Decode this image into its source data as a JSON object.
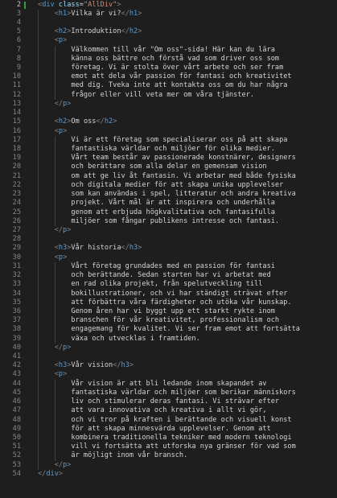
{
  "editor": {
    "active_line": 2,
    "modified_lines": [
      2
    ],
    "lines": [
      {
        "n": 2,
        "indent": 0,
        "kind": "open",
        "tag": "div",
        "attr": "class",
        "value": "\"AllDiv\""
      },
      {
        "n": 3,
        "indent": 1,
        "kind": "element",
        "tag": "h1",
        "text": "Vilka är vi?"
      },
      {
        "n": 4,
        "indent": 1,
        "kind": "blank"
      },
      {
        "n": 5,
        "indent": 1,
        "kind": "element",
        "tag": "h2",
        "text": "Introduktion"
      },
      {
        "n": 6,
        "indent": 1,
        "kind": "open",
        "tag": "p"
      },
      {
        "n": 7,
        "indent": 2,
        "kind": "text",
        "text": "Välkommen till vår \"Om oss\"-sida! Här kan du lära"
      },
      {
        "n": 8,
        "indent": 2,
        "kind": "text",
        "text": "känna oss bättre och förstå vad som driver oss som"
      },
      {
        "n": 9,
        "indent": 2,
        "kind": "text",
        "text": "företag. Vi är stolta över vårt arbete och ser fram"
      },
      {
        "n": 10,
        "indent": 2,
        "kind": "text",
        "text": "emot att dela vår passion för fantasi och kreativitet"
      },
      {
        "n": 11,
        "indent": 2,
        "kind": "text",
        "text": "med dig. Tveka inte att kontakta oss om du har några"
      },
      {
        "n": 12,
        "indent": 2,
        "kind": "text",
        "text": "frågor eller vill veta mer om våra tjänster."
      },
      {
        "n": 13,
        "indent": 1,
        "kind": "close",
        "tag": "p"
      },
      {
        "n": 14,
        "indent": 1,
        "kind": "blank"
      },
      {
        "n": 15,
        "indent": 1,
        "kind": "element",
        "tag": "h2",
        "text": "Om oss"
      },
      {
        "n": 16,
        "indent": 1,
        "kind": "open",
        "tag": "p"
      },
      {
        "n": 17,
        "indent": 2,
        "kind": "text",
        "text": "Vi är ett företag som specialiserar oss på att skapa"
      },
      {
        "n": 18,
        "indent": 2,
        "kind": "text",
        "text": "fantastiska världar och miljöer för olika medier."
      },
      {
        "n": 19,
        "indent": 2,
        "kind": "text",
        "text": "Vårt team består av passionerade konstnärer, designers"
      },
      {
        "n": 20,
        "indent": 2,
        "kind": "text",
        "text": "och berättare som alla delar en gemensam vision"
      },
      {
        "n": 21,
        "indent": 2,
        "kind": "text",
        "text": "om att ge liv åt fantasin. Vi arbetar med både fysiska"
      },
      {
        "n": 22,
        "indent": 2,
        "kind": "text",
        "text": "och digitala medier för att skapa unika upplevelser"
      },
      {
        "n": 23,
        "indent": 2,
        "kind": "text",
        "text": "som kan användas i spel, litteratur och andra kreativa"
      },
      {
        "n": 24,
        "indent": 2,
        "kind": "text",
        "text": "projekt. Vårt mål är att inspirera och underhålla"
      },
      {
        "n": 25,
        "indent": 2,
        "kind": "text",
        "text": "genom att erbjuda högkvalitativa och fantasifulla"
      },
      {
        "n": 26,
        "indent": 2,
        "kind": "text",
        "text": "miljöer som fångar publikens intresse och fantasi."
      },
      {
        "n": 27,
        "indent": 1,
        "kind": "close",
        "tag": "p"
      },
      {
        "n": 28,
        "indent": 1,
        "kind": "blank"
      },
      {
        "n": 29,
        "indent": 1,
        "kind": "element",
        "tag": "h3",
        "text": "Vår historia"
      },
      {
        "n": 30,
        "indent": 1,
        "kind": "open",
        "tag": "p"
      },
      {
        "n": 31,
        "indent": 2,
        "kind": "text",
        "text": "Vårt företag grundades med en passion för fantasi"
      },
      {
        "n": 32,
        "indent": 2,
        "kind": "text",
        "text": "och berättande. Sedan starten har vi arbetat med"
      },
      {
        "n": 33,
        "indent": 2,
        "kind": "text",
        "text": "en rad olika projekt, från spelutveckling till"
      },
      {
        "n": 34,
        "indent": 2,
        "kind": "text",
        "text": "bokillustrationer, och vi har ständigt strävat efter"
      },
      {
        "n": 35,
        "indent": 2,
        "kind": "text",
        "text": "att förbättra våra färdigheter och utöka vår kunskap."
      },
      {
        "n": 36,
        "indent": 2,
        "kind": "text",
        "text": "Genom åren har vi byggt upp ett starkt rykte inom"
      },
      {
        "n": 37,
        "indent": 2,
        "kind": "text",
        "text": "branschen för vår kreativitet, professionalism och"
      },
      {
        "n": 38,
        "indent": 2,
        "kind": "text",
        "text": "engagemang för kvalitet. Vi ser fram emot att fortsätta"
      },
      {
        "n": 39,
        "indent": 2,
        "kind": "text",
        "text": "växa och utvecklas i framtiden."
      },
      {
        "n": 40,
        "indent": 1,
        "kind": "close",
        "tag": "p"
      },
      {
        "n": 41,
        "indent": 1,
        "kind": "blank"
      },
      {
        "n": 42,
        "indent": 1,
        "kind": "element",
        "tag": "h3",
        "text": "Vår vision"
      },
      {
        "n": 43,
        "indent": 1,
        "kind": "open",
        "tag": "p"
      },
      {
        "n": 44,
        "indent": 2,
        "kind": "text",
        "text": "Vår vision är att bli ledande inom skapandet av"
      },
      {
        "n": 45,
        "indent": 2,
        "kind": "text",
        "text": "fantastiska världar och miljöer som berikar människors"
      },
      {
        "n": 46,
        "indent": 2,
        "kind": "text",
        "text": "liv och stimulerar deras fantasi. Vi strävar efter"
      },
      {
        "n": 47,
        "indent": 2,
        "kind": "text",
        "text": "att vara innovativa och kreativa i allt vi gör,"
      },
      {
        "n": 48,
        "indent": 2,
        "kind": "text",
        "text": "och vi tror på kraften i berättande och visuell konst"
      },
      {
        "n": 49,
        "indent": 2,
        "kind": "text",
        "text": "för att skapa minnesvärda upplevelser. Genom att"
      },
      {
        "n": 50,
        "indent": 2,
        "kind": "text",
        "text": "kombinera traditionella tekniker med modern teknologi"
      },
      {
        "n": 51,
        "indent": 2,
        "kind": "text",
        "text": "vill vi fortsätta att utforska nya gränser för vad som"
      },
      {
        "n": 52,
        "indent": 2,
        "kind": "text",
        "text": "är möjligt inom vår bransch."
      },
      {
        "n": 53,
        "indent": 1,
        "kind": "close",
        "tag": "p"
      },
      {
        "n": 54,
        "indent": 0,
        "kind": "close",
        "tag": "div"
      }
    ]
  },
  "colors": {
    "background": "#1e1e1e",
    "line_number": "#858585",
    "line_number_active": "#c6c6c6",
    "tag": "#569cd6",
    "punctuation": "#808080",
    "attribute": "#9cdcfe",
    "string": "#ce9178",
    "text": "#d4d4d4",
    "indent_guide": "#404040",
    "modified_marker": "#2ea043"
  }
}
